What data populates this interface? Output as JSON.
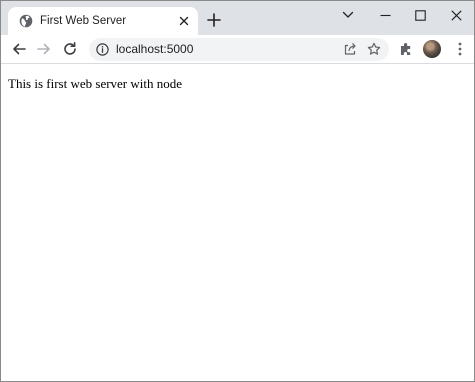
{
  "browser": {
    "tab": {
      "title": "First Web Server",
      "favicon": "globe-icon",
      "close_icon": "close-icon"
    },
    "new_tab_icon": "plus-icon",
    "window_controls": [
      "chevron-down-icon",
      "minimize-icon",
      "maximize-icon",
      "close-icon"
    ]
  },
  "toolbar": {
    "nav_icons": [
      "back-arrow-icon",
      "forward-arrow-icon",
      "reload-icon"
    ],
    "omnibox": {
      "url": "localhost:5000",
      "site_info_icon": "info-icon",
      "share_icon": "share-icon",
      "bookmark_icon": "star-icon"
    },
    "extensions_icon": "puzzle-icon",
    "menu_icon": "kebab-menu-icon"
  },
  "page": {
    "body_text": "This is first web server with node"
  },
  "colors": {
    "tabstrip": "#dee1e6",
    "omnibox": "#f1f3f4",
    "icon": "#5f6368",
    "text": "#202124"
  }
}
